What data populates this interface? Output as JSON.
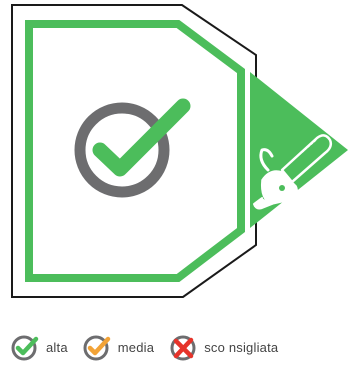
{
  "colors": {
    "green": "#4cbd5b",
    "gray": "#6d6d6f",
    "orange": "#f2a337",
    "red": "#e6332a",
    "outline": "#1a1a1a"
  },
  "badge": {
    "rating_icon": "check-icon",
    "category_icon": "chainsaw-icon"
  },
  "legend": {
    "items": [
      {
        "icon": "check-circle-green-icon",
        "label": "alta"
      },
      {
        "icon": "check-circle-orange-icon",
        "label": "media"
      },
      {
        "icon": "cross-circle-red-icon",
        "label": "sco nsigliata"
      }
    ]
  }
}
